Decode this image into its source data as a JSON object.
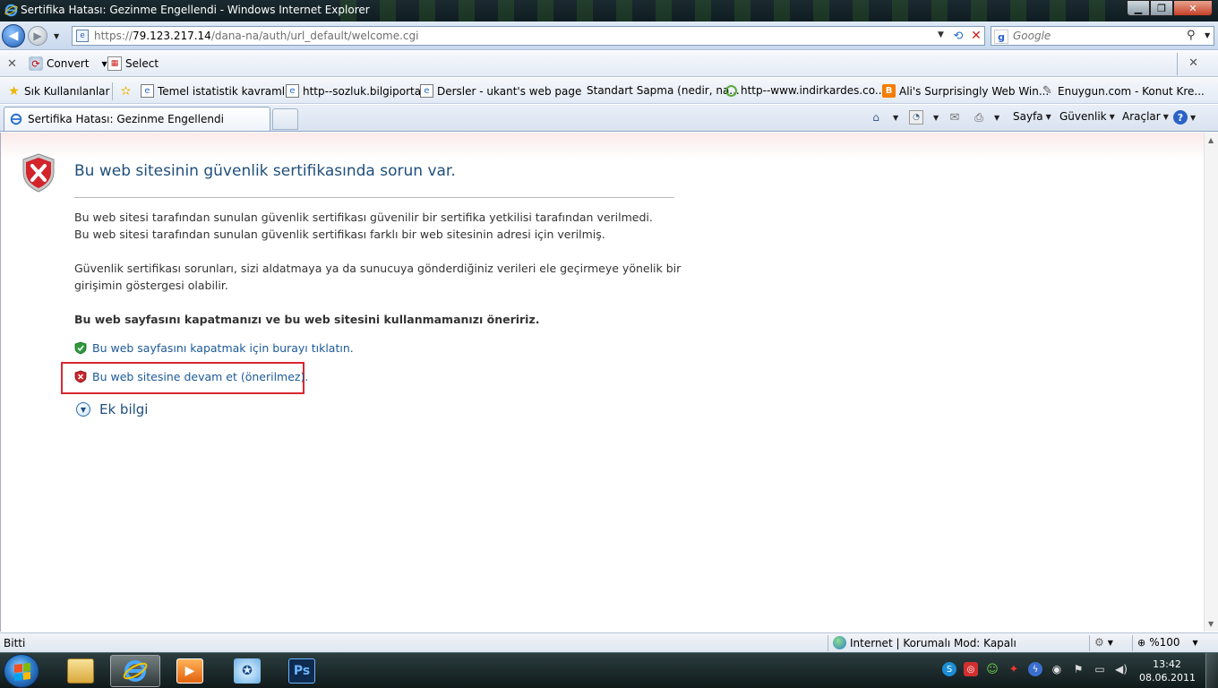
{
  "window": {
    "title": "Sertifika Hatası: Gezinme Engellendi - Windows Internet Explorer",
    "min_glyph": "▁",
    "max_glyph": "❐",
    "close_glyph": "✕"
  },
  "address_bar": {
    "url_prefix": "https://",
    "url_host": "79.123.217.14",
    "url_path": "/dana-na/auth/url_default/welcome.cgi",
    "search_placeholder": "Google"
  },
  "convert_toolbar": {
    "convert_label": "Convert",
    "select_label": "Select"
  },
  "favorites": {
    "favorites_label": "Sık Kullanılanlar",
    "items": [
      "Temel istatistik kavramlar",
      "http--sozluk.bilgiportal",
      "Dersler - ukant's web page",
      "Standart Sapma (nedir, na...",
      "http--www.indirkardes.co...",
      "Ali's Surprisingly Web Win...",
      "Enuygun.com - Konut Kre..."
    ]
  },
  "tabs": {
    "active_label": "Sertifika Hatası: Gezinme Engellendi"
  },
  "command_bar": {
    "page_label": "Sayfa",
    "safety_label": "Güvenlik",
    "tools_label": "Araçlar"
  },
  "error_page": {
    "title": "Bu web sitesinin güvenlik sertifikasında sorun var.",
    "line1": "Bu web sitesi tarafından sunulan güvenlik sertifikası güvenilir bir sertifika yetkilisi tarafından verilmedi.",
    "line2": "Bu web sitesi tarafından sunulan güvenlik sertifikası farklı bir web sitesinin adresi için verilmiş.",
    "line3": "Güvenlik sertifikası sorunları, sizi aldatmaya ya da sunucuya gönderdiğiniz verileri ele geçirmeye yönelik bir",
    "line4": "girişimin göstergesi olabilir.",
    "recommendation": "Bu web sayfasını kapatmanızı ve bu web sitesini kullanmamanızı öneririz.",
    "close_link": "Bu web sayfasını kapatmak için burayı tıklatın.",
    "continue_link": "Bu web sitesine devam et (önerilmez).",
    "more_info": "Ek bilgi"
  },
  "status_bar": {
    "status": "Bitti",
    "zone": "Internet | Korumalı Mod: Kapalı",
    "zoom": "%100"
  },
  "taskbar": {
    "photoshop_label": "Ps",
    "time": "13:42",
    "date": "08.06.2011"
  },
  "colors": {
    "link": "#1c5a99",
    "title": "#1f4f7c",
    "highlight_box": "#d8282e"
  }
}
